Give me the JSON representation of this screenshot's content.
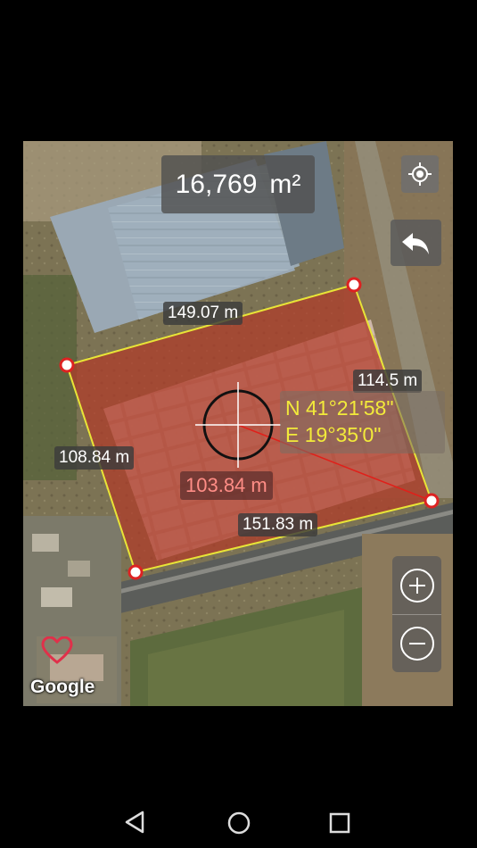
{
  "area": {
    "value": "16,769",
    "unit": "m²"
  },
  "edges": {
    "top": "149.07 m",
    "right": "114.5 m",
    "left": "108.84 m",
    "bottom": "151.83 m",
    "radius": "103.84 m"
  },
  "coords": {
    "lat": "N 41°21'58\"",
    "lon": "E 19°35'0\""
  },
  "brand": "Google",
  "colors": {
    "polygon_fill": "#b13a28",
    "polygon_stroke": "#e8e437",
    "coord_text": "#f2ea3a",
    "radius_text": "#ff8d86"
  },
  "icons": [
    "my-location-icon",
    "undo-icon",
    "zoom-in-icon",
    "zoom-out-icon",
    "heart-marker-icon",
    "back-icon",
    "home-icon",
    "recents-icon"
  ]
}
